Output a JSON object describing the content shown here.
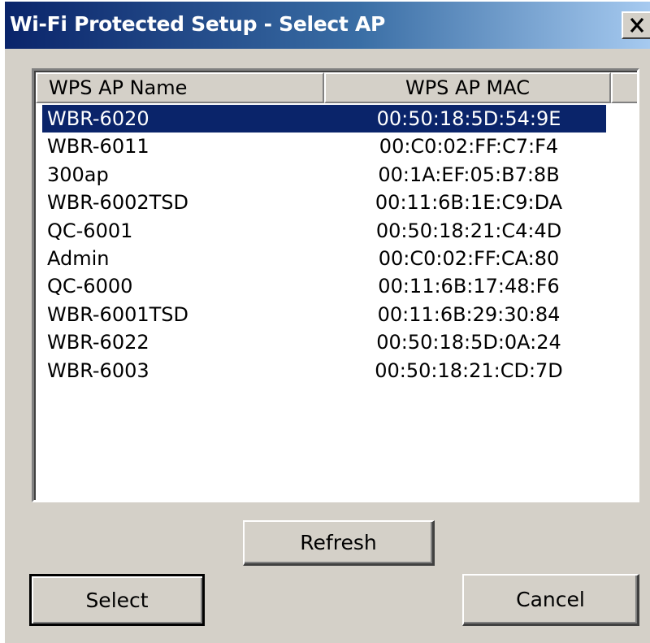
{
  "window": {
    "title": "Wi-Fi Protected Setup - Select AP"
  },
  "list": {
    "columns": [
      "WPS AP Name",
      "WPS AP MAC"
    ],
    "selected_index": 0,
    "rows": [
      {
        "name": "WBR-6020",
        "mac": "00:50:18:5D:54:9E"
      },
      {
        "name": "WBR-6011",
        "mac": "00:C0:02:FF:C7:F4"
      },
      {
        "name": "300ap",
        "mac": "00:1A:EF:05:B7:8B"
      },
      {
        "name": "WBR-6002TSD",
        "mac": "00:11:6B:1E:C9:DA"
      },
      {
        "name": "QC-6001",
        "mac": "00:50:18:21:C4:4D"
      },
      {
        "name": "Admin",
        "mac": "00:C0:02:FF:CA:80"
      },
      {
        "name": "QC-6000",
        "mac": "00:11:6B:17:48:F6"
      },
      {
        "name": "WBR-6001TSD",
        "mac": "00:11:6B:29:30:84"
      },
      {
        "name": "WBR-6022",
        "mac": "00:50:18:5D:0A:24"
      },
      {
        "name": "WBR-6003",
        "mac": "00:50:18:21:CD:7D"
      }
    ]
  },
  "buttons": {
    "refresh": "Refresh",
    "select": "Select",
    "cancel": "Cancel"
  },
  "icons": {
    "close": "close-icon"
  },
  "colors": {
    "titlebar_start": "#0a246a",
    "titlebar_end": "#a6caf0",
    "selection": "#0a246a",
    "face": "#d4d0c8"
  }
}
